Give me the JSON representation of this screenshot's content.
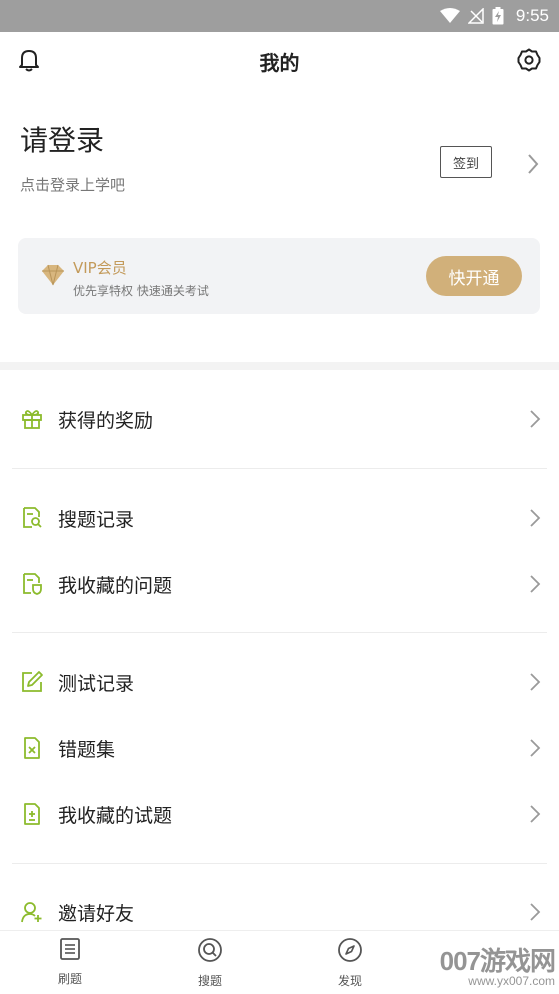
{
  "status_bar": {
    "time": "9:55",
    "icons": [
      "wifi-icon",
      "signal-off-icon",
      "battery-charging-icon"
    ]
  },
  "header": {
    "title": "我的",
    "left_icon": "bell-icon",
    "right_icon": "gear-icon"
  },
  "login": {
    "title": "请登录",
    "subtitle": "点击登录上学吧",
    "checkin_label": "签到"
  },
  "vip": {
    "title": "VIP会员",
    "subtitle": "优先享特权 快速通关考试",
    "button_label": "快开通",
    "accent": "#c39a5a",
    "button_color": "#d1b07a"
  },
  "menu": {
    "accent": "#8cbb2d",
    "items": [
      {
        "label": "获得的奖励",
        "icon": "gift-icon"
      },
      {
        "label": "搜题记录",
        "icon": "search-record-icon"
      },
      {
        "label": "我收藏的问题",
        "icon": "favorite-question-icon"
      },
      {
        "label": "测试记录",
        "icon": "edit-icon"
      },
      {
        "label": "错题集",
        "icon": "wrong-file-icon"
      },
      {
        "label": "我收藏的试题",
        "icon": "favorite-exam-icon"
      },
      {
        "label": "邀请好友",
        "icon": "invite-friend-icon"
      }
    ]
  },
  "tabbar": {
    "tabs": [
      {
        "label": "刷题",
        "icon": "practice-icon"
      },
      {
        "label": "搜题",
        "icon": "search-tab-icon"
      },
      {
        "label": "发现",
        "icon": "compass-icon"
      }
    ]
  },
  "watermark": {
    "main": "007游戏网",
    "url": "www.yx007.com"
  }
}
